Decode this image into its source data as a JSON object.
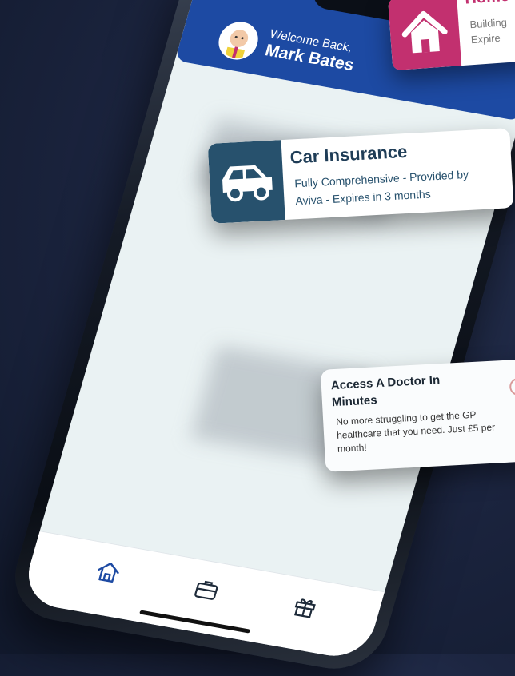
{
  "user": {
    "welcome": "Welcome Back,",
    "name": "Mark Bates"
  },
  "cards": {
    "home": {
      "title": "Home",
      "desc_line1": "Building",
      "desc_line2": "Expire"
    },
    "car": {
      "title": "Car Insurance",
      "desc": "Fully Comprehensive - Provided by Aviva - Expires in 3 months"
    },
    "doctor": {
      "title": "Access A Doctor In Minutes",
      "desc": "No more struggling to get the GP healthcare that you need. Just £5 per month!"
    }
  },
  "tabs": [
    "home-icon",
    "briefcase-icon",
    "gift-icon"
  ],
  "colors": {
    "header": "#1d4aa3",
    "home_accent": "#c2306f",
    "car_tile": "#27516d",
    "background": "#1c2540"
  }
}
